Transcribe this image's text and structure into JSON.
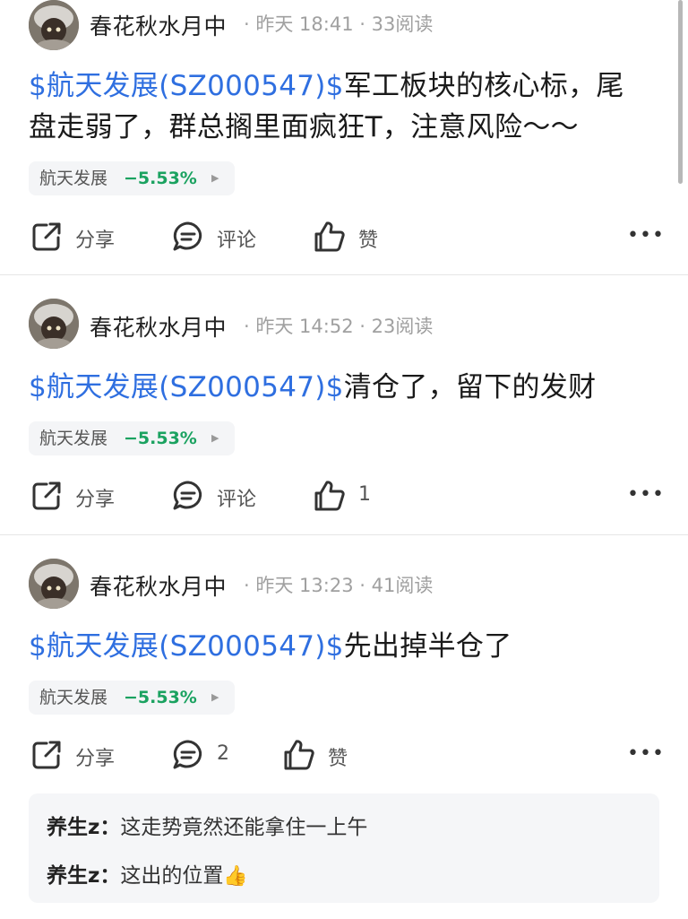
{
  "posts": [
    {
      "author": "春花秋水月中",
      "time": "昨天 18:41",
      "reads": "33阅读",
      "stock_link": "$航天发展(SZ000547)$",
      "text_line1": "军工板块的核心标，尾",
      "text_line2": "盘走弱了，群总搁里面疯狂T，注意风险～～",
      "chip": {
        "name": "航天发展",
        "change": "−5.53%",
        "arrow": "▶"
      },
      "actions": {
        "share": "分享",
        "comment": "评论",
        "like": "赞"
      },
      "more": "•••"
    },
    {
      "author": "春花秋水月中",
      "time": "昨天 14:52",
      "reads": "23阅读",
      "stock_link": "$航天发展(SZ000547)$",
      "text": "清仓了，留下的发财",
      "chip": {
        "name": "航天发展",
        "change": "−5.53%",
        "arrow": "▶"
      },
      "actions": {
        "share": "分享",
        "comment": "评论",
        "like": "1"
      },
      "more": "•••"
    },
    {
      "author": "春花秋水月中",
      "time": "昨天 13:23",
      "reads": "41阅读",
      "stock_link": "$航天发展(SZ000547)$",
      "text": "先出掉半仓了",
      "chip": {
        "name": "航天发展",
        "change": "−5.53%",
        "arrow": "▶"
      },
      "actions": {
        "share": "分享",
        "comment": "2",
        "like": "赞"
      },
      "more": "•••",
      "comments": [
        {
          "user": "养生z：",
          "text": "这走势竟然还能拿住一上午"
        },
        {
          "user": "养生z：",
          "text": "这出的位置",
          "emoji": "👍"
        }
      ]
    }
  ],
  "colors": {
    "link": "#2f6fe0",
    "down": "#1aa260",
    "chip_bg": "#f4f5f7",
    "comment_bg": "#f5f6f8"
  },
  "icons": {
    "share": "share-icon",
    "comment": "comment-icon",
    "like": "thumbs-up-icon",
    "more": "more-icon"
  }
}
